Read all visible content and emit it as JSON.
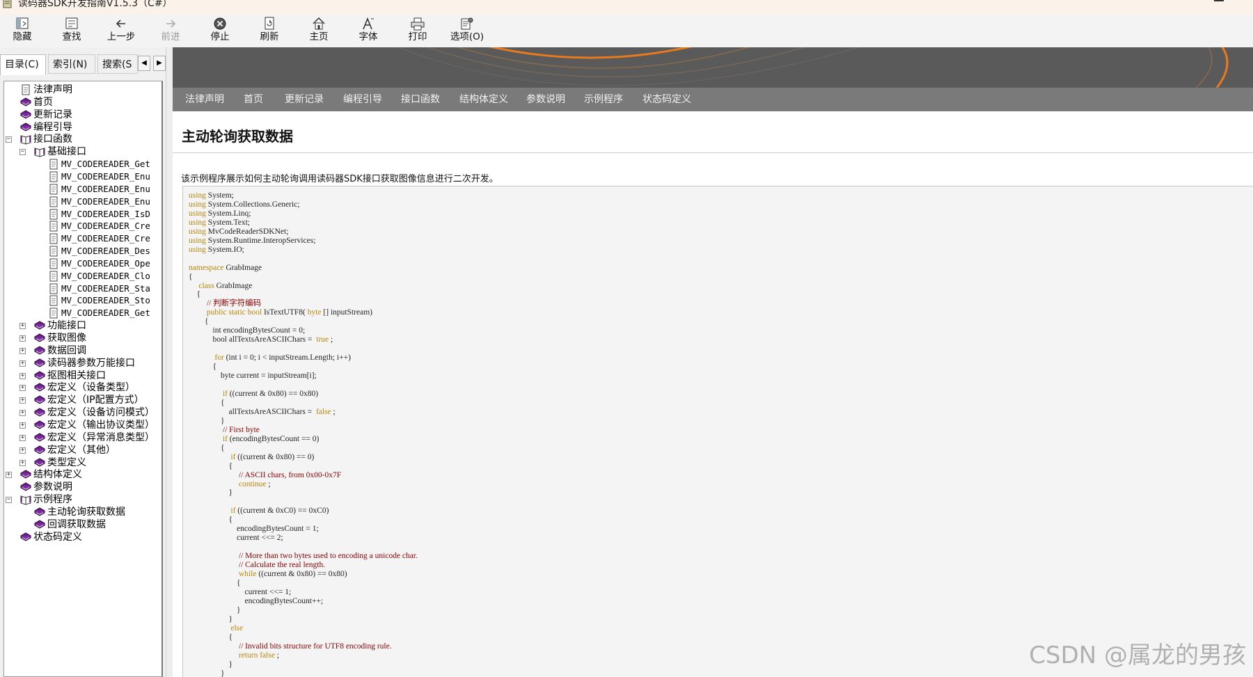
{
  "window": {
    "title": "读码器SDK开发指南V1.5.3（C#）",
    "icon": "help-book-icon"
  },
  "toolbar": {
    "buttons": [
      {
        "label": "隐藏",
        "icon": "hide-pane-icon"
      },
      {
        "label": "查找",
        "icon": "locate-icon"
      },
      {
        "label": "上一步",
        "icon": "back-arrow-icon"
      },
      {
        "label": "前进",
        "icon": "forward-arrow-icon",
        "disabled": true
      },
      {
        "label": "停止",
        "icon": "stop-icon"
      },
      {
        "label": "刷新",
        "icon": "refresh-icon"
      },
      {
        "label": "主页",
        "icon": "home-icon"
      },
      {
        "label": "字体",
        "icon": "font-icon"
      },
      {
        "label": "打印",
        "icon": "print-icon"
      },
      {
        "label": "选项(O)",
        "icon": "options-icon"
      }
    ]
  },
  "left_tabs": [
    "目录(C)",
    "索引(N)",
    "搜索(S"
  ],
  "tree": [
    {
      "label": "法律声明",
      "icon": "page-icon",
      "level": 0,
      "expander": ""
    },
    {
      "label": "首页",
      "icon": "closed-book-icon",
      "level": 0,
      "expander": ""
    },
    {
      "label": "更新记录",
      "icon": "closed-book-icon",
      "level": 0,
      "expander": ""
    },
    {
      "label": "编程引导",
      "icon": "closed-book-icon",
      "level": 0,
      "expander": ""
    },
    {
      "label": "接口函数",
      "icon": "open-book-icon",
      "level": 0,
      "expander": "−"
    },
    {
      "label": "基础接口",
      "icon": "open-book-icon",
      "level": 1,
      "expander": "−"
    },
    {
      "label": "MV_CODEREADER_Get",
      "icon": "page-icon",
      "level": 2,
      "expander": "",
      "mono": true
    },
    {
      "label": "MV_CODEREADER_Enu",
      "icon": "page-icon",
      "level": 2,
      "expander": "",
      "mono": true
    },
    {
      "label": "MV_CODEREADER_Enu",
      "icon": "page-icon",
      "level": 2,
      "expander": "",
      "mono": true
    },
    {
      "label": "MV_CODEREADER_Enu",
      "icon": "page-icon",
      "level": 2,
      "expander": "",
      "mono": true
    },
    {
      "label": "MV_CODEREADER_IsD",
      "icon": "page-icon",
      "level": 2,
      "expander": "",
      "mono": true
    },
    {
      "label": "MV_CODEREADER_Cre",
      "icon": "page-icon",
      "level": 2,
      "expander": "",
      "mono": true
    },
    {
      "label": "MV_CODEREADER_Cre",
      "icon": "page-icon",
      "level": 2,
      "expander": "",
      "mono": true
    },
    {
      "label": "MV_CODEREADER_Des",
      "icon": "page-icon",
      "level": 2,
      "expander": "",
      "mono": true
    },
    {
      "label": "MV_CODEREADER_Ope",
      "icon": "page-icon",
      "level": 2,
      "expander": "",
      "mono": true
    },
    {
      "label": "MV_CODEREADER_Clo",
      "icon": "page-icon",
      "level": 2,
      "expander": "",
      "mono": true
    },
    {
      "label": "MV_CODEREADER_Sta",
      "icon": "page-icon",
      "level": 2,
      "expander": "",
      "mono": true
    },
    {
      "label": "MV_CODEREADER_Sto",
      "icon": "page-icon",
      "level": 2,
      "expander": "",
      "mono": true
    },
    {
      "label": "MV_CODEREADER_Get",
      "icon": "page-icon",
      "level": 2,
      "expander": "",
      "mono": true
    },
    {
      "label": "功能接口",
      "icon": "closed-book-icon",
      "level": 1,
      "expander": "+"
    },
    {
      "label": "获取图像",
      "icon": "closed-book-icon",
      "level": 1,
      "expander": "+"
    },
    {
      "label": "数据回调",
      "icon": "closed-book-icon",
      "level": 1,
      "expander": "+"
    },
    {
      "label": "读码器参数万能接口",
      "icon": "closed-book-icon",
      "level": 1,
      "expander": "+"
    },
    {
      "label": "抠图相关接口",
      "icon": "closed-book-icon",
      "level": 1,
      "expander": "+"
    },
    {
      "label": "宏定义（设备类型）",
      "icon": "closed-book-icon",
      "level": 1,
      "expander": "+"
    },
    {
      "label": "宏定义（IP配置方式）",
      "icon": "closed-book-icon",
      "level": 1,
      "expander": "+"
    },
    {
      "label": "宏定义（设备访问模式）",
      "icon": "closed-book-icon",
      "level": 1,
      "expander": "+"
    },
    {
      "label": "宏定义（输出协议类型）",
      "icon": "closed-book-icon",
      "level": 1,
      "expander": "+"
    },
    {
      "label": "宏定义（异常消息类型）",
      "icon": "closed-book-icon",
      "level": 1,
      "expander": "+"
    },
    {
      "label": "宏定义（其他）",
      "icon": "closed-book-icon",
      "level": 1,
      "expander": "+"
    },
    {
      "label": "类型定义",
      "icon": "closed-book-icon",
      "level": 1,
      "expander": "+"
    },
    {
      "label": "结构体定义",
      "icon": "closed-book-icon",
      "level": 0,
      "expander": "+"
    },
    {
      "label": "参数说明",
      "icon": "closed-book-icon",
      "level": 0,
      "expander": ""
    },
    {
      "label": "示例程序",
      "icon": "open-book-icon",
      "level": 0,
      "expander": "−"
    },
    {
      "label": "主动轮询获取数据",
      "icon": "closed-book-icon",
      "level": 1,
      "expander": ""
    },
    {
      "label": "回调获取数据",
      "icon": "closed-book-icon",
      "level": 1,
      "expander": ""
    },
    {
      "label": "状态码定义",
      "icon": "closed-book-icon",
      "level": 0,
      "expander": ""
    }
  ],
  "nav": [
    "法律声明",
    "首页",
    "更新记录",
    "编程引导",
    "接口函数",
    "结构体定义",
    "参数说明",
    "示例程序",
    "状态码定义"
  ],
  "page": {
    "title": "主动轮询获取数据",
    "description": "该示例程序展示如何主动轮询调用读码器SDK接口获取图像信息进行二次开发。"
  },
  "code_lines": [
    [
      [
        "kw",
        "using"
      ],
      [
        "",
        "System;"
      ]
    ],
    [
      [
        "kw",
        "using"
      ],
      [
        "",
        "System.Collections.Generic;"
      ]
    ],
    [
      [
        "kw",
        "using"
      ],
      [
        "",
        "System.Linq;"
      ]
    ],
    [
      [
        "kw",
        "using"
      ],
      [
        "",
        "System.Text;"
      ]
    ],
    [
      [
        "kw",
        "using"
      ],
      [
        "",
        "MvCodeReaderSDKNet;"
      ]
    ],
    [
      [
        "kw",
        "using"
      ],
      [
        "",
        "System.Runtime.InteropServices;"
      ]
    ],
    [
      [
        "kw",
        "using"
      ],
      [
        "",
        "System.IO;"
      ]
    ],
    [],
    [
      [
        "kw",
        "namespace"
      ],
      [
        "",
        "GrabImage"
      ]
    ],
    [
      [
        "",
        "{"
      ]
    ],
    [
      [
        "",
        "    "
      ],
      [
        "kw",
        "class"
      ],
      [
        "",
        "GrabImage"
      ]
    ],
    [
      [
        "",
        "    {"
      ]
    ],
    [
      [
        "",
        "        "
      ],
      [
        "cm",
        "// 判断字符编码"
      ]
    ],
    [
      [
        "",
        "        "
      ],
      [
        "kw",
        "public static bool"
      ],
      [
        "",
        "IsTextUTF8("
      ],
      [
        "kw",
        "byte"
      ],
      [
        "",
        "[] inputStream)"
      ]
    ],
    [
      [
        "",
        "        {"
      ]
    ],
    [
      [
        "",
        "            int encodingBytesCount = 0;"
      ]
    ],
    [
      [
        "",
        "            bool allTextsAreASCIIChars = "
      ],
      [
        "kw",
        "true"
      ],
      [
        "",
        ";"
      ]
    ],
    [],
    [
      [
        "",
        "            "
      ],
      [
        "kw",
        "for"
      ],
      [
        "",
        "(int i = 0; i < inputStream.Length; i++)"
      ]
    ],
    [
      [
        "",
        "            {"
      ]
    ],
    [
      [
        "",
        "                byte current = inputStream[i];"
      ]
    ],
    [],
    [
      [
        "",
        "                "
      ],
      [
        "kw",
        "if"
      ],
      [
        "",
        "((current & 0x80) == 0x80)"
      ]
    ],
    [
      [
        "",
        "                {"
      ]
    ],
    [
      [
        "",
        "                    allTextsAreASCIIChars = "
      ],
      [
        "kw",
        "false"
      ],
      [
        "",
        ";"
      ]
    ],
    [
      [
        "",
        "                }"
      ]
    ],
    [
      [
        "",
        "                "
      ],
      [
        "cm",
        "// First byte"
      ]
    ],
    [
      [
        "",
        "                "
      ],
      [
        "kw",
        "if"
      ],
      [
        "",
        "(encodingBytesCount == 0)"
      ]
    ],
    [
      [
        "",
        "                {"
      ]
    ],
    [
      [
        "",
        "                    "
      ],
      [
        "kw",
        "if"
      ],
      [
        "",
        "((current & 0x80) == 0)"
      ]
    ],
    [
      [
        "",
        "                    {"
      ]
    ],
    [
      [
        "",
        "                        "
      ],
      [
        "cm",
        "// ASCII chars, from 0x00-0x7F"
      ]
    ],
    [
      [
        "",
        "                        "
      ],
      [
        "kw",
        "continue"
      ],
      [
        "",
        ";"
      ]
    ],
    [
      [
        "",
        "                    }"
      ]
    ],
    [],
    [
      [
        "",
        "                    "
      ],
      [
        "kw",
        "if"
      ],
      [
        "",
        "((current & 0xC0) == 0xC0)"
      ]
    ],
    [
      [
        "",
        "                    {"
      ]
    ],
    [
      [
        "",
        "                        encodingBytesCount = 1;"
      ]
    ],
    [
      [
        "",
        "                        current <<= 2;"
      ]
    ],
    [],
    [
      [
        "",
        "                        "
      ],
      [
        "cm",
        "// More than two bytes used to encoding a unicode char."
      ]
    ],
    [
      [
        "",
        "                        "
      ],
      [
        "cm",
        "// Calculate the real length."
      ]
    ],
    [
      [
        "",
        "                        "
      ],
      [
        "kw",
        "while"
      ],
      [
        "",
        "((current & 0x80) == 0x80)"
      ]
    ],
    [
      [
        "",
        "                        {"
      ]
    ],
    [
      [
        "",
        "                            current <<= 1;"
      ]
    ],
    [
      [
        "",
        "                            encodingBytesCount++;"
      ]
    ],
    [
      [
        "",
        "                        }"
      ]
    ],
    [
      [
        "",
        "                    }"
      ]
    ],
    [
      [
        "",
        "                    "
      ],
      [
        "kw",
        "else"
      ]
    ],
    [
      [
        "",
        "                    {"
      ]
    ],
    [
      [
        "",
        "                        "
      ],
      [
        "cm",
        "// Invalid bits structure for UTF8 encoding rule."
      ]
    ],
    [
      [
        "",
        "                        "
      ],
      [
        "kw",
        "return false"
      ],
      [
        "",
        ";"
      ]
    ],
    [
      [
        "",
        "                    }"
      ]
    ],
    [
      [
        "",
        "                }"
      ]
    ]
  ],
  "watermark": "CSDN @属龙的男孩"
}
